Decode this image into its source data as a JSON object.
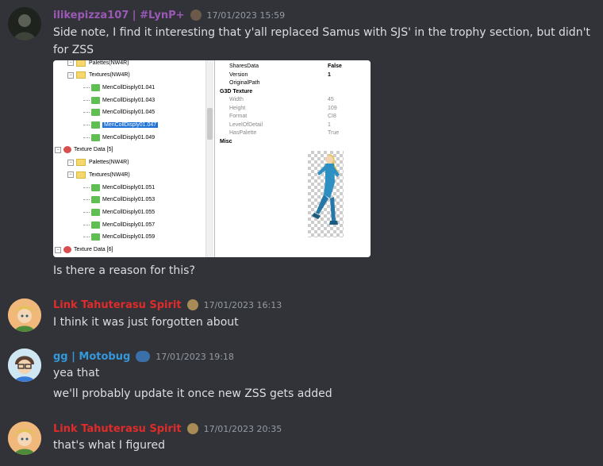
{
  "messages": [
    {
      "username": "ilikepizza107 | #LynP+",
      "username_color": "#9b59b6",
      "timestamp": "17/01/2023 15:59",
      "lines": [
        "Side note, I find it interesting that y'all replaced Samus with SJS' in the trophy section, but didn't",
        "for ZSS"
      ],
      "after_attachment": "Is there a reason for this?"
    },
    {
      "username": "Link Tahuterasu Spirit",
      "username_color": "#e02b2b",
      "timestamp": "17/01/2023 16:13",
      "lines": [
        "I think it was just forgotten about"
      ]
    },
    {
      "username": "gg | Motobug",
      "username_color": "#3498db",
      "timestamp": "17/01/2023 19:18",
      "lines": [
        "yea that",
        "we'll probably update it once new ZSS gets added"
      ]
    },
    {
      "username": "Link Tahuterasu Spirit",
      "username_color": "#e02b2b",
      "timestamp": "17/01/2023 20:35",
      "lines": [
        "that's what I figured"
      ]
    }
  ],
  "attachment": {
    "tree": [
      {
        "label": "Palettes(NW4R)",
        "icon": "folder"
      },
      {
        "label": "Textures(NW4R)",
        "icon": "folder"
      },
      {
        "label": "MenCollDisply01.041",
        "icon": "texture"
      },
      {
        "label": "MenCollDisply01.043",
        "icon": "texture"
      },
      {
        "label": "MenCollDisply01.045",
        "icon": "texture"
      },
      {
        "label": "MenCollDisply01.047",
        "icon": "texture",
        "selected": true
      },
      {
        "label": "MenCollDisply01.049",
        "icon": "texture"
      },
      {
        "label": "Texture Data [5]",
        "icon": "data"
      },
      {
        "label": "Palettes(NW4R)",
        "icon": "folder"
      },
      {
        "label": "Textures(NW4R)",
        "icon": "folder"
      },
      {
        "label": "MenCollDisply01.051",
        "icon": "texture"
      },
      {
        "label": "MenCollDisply01.053",
        "icon": "texture"
      },
      {
        "label": "MenCollDisply01.055",
        "icon": "texture"
      },
      {
        "label": "MenCollDisply01.057",
        "icon": "texture"
      },
      {
        "label": "MenCollDisply01.059",
        "icon": "texture"
      },
      {
        "label": "Texture Data [6]",
        "icon": "data"
      }
    ],
    "properties": [
      {
        "key": "SharesData",
        "value": "False"
      },
      {
        "key": "Version",
        "value": "1"
      },
      {
        "key": "OriginalPath",
        "value": ""
      },
      {
        "category": "G3D Texture"
      },
      {
        "key": "Width",
        "value": "45"
      },
      {
        "key": "Height",
        "value": "109"
      },
      {
        "key": "Format",
        "value": "CI8"
      },
      {
        "key": "LevelOfDetail",
        "value": "1"
      },
      {
        "key": "HasPalette",
        "value": "True"
      },
      {
        "category": "Misc"
      }
    ]
  }
}
